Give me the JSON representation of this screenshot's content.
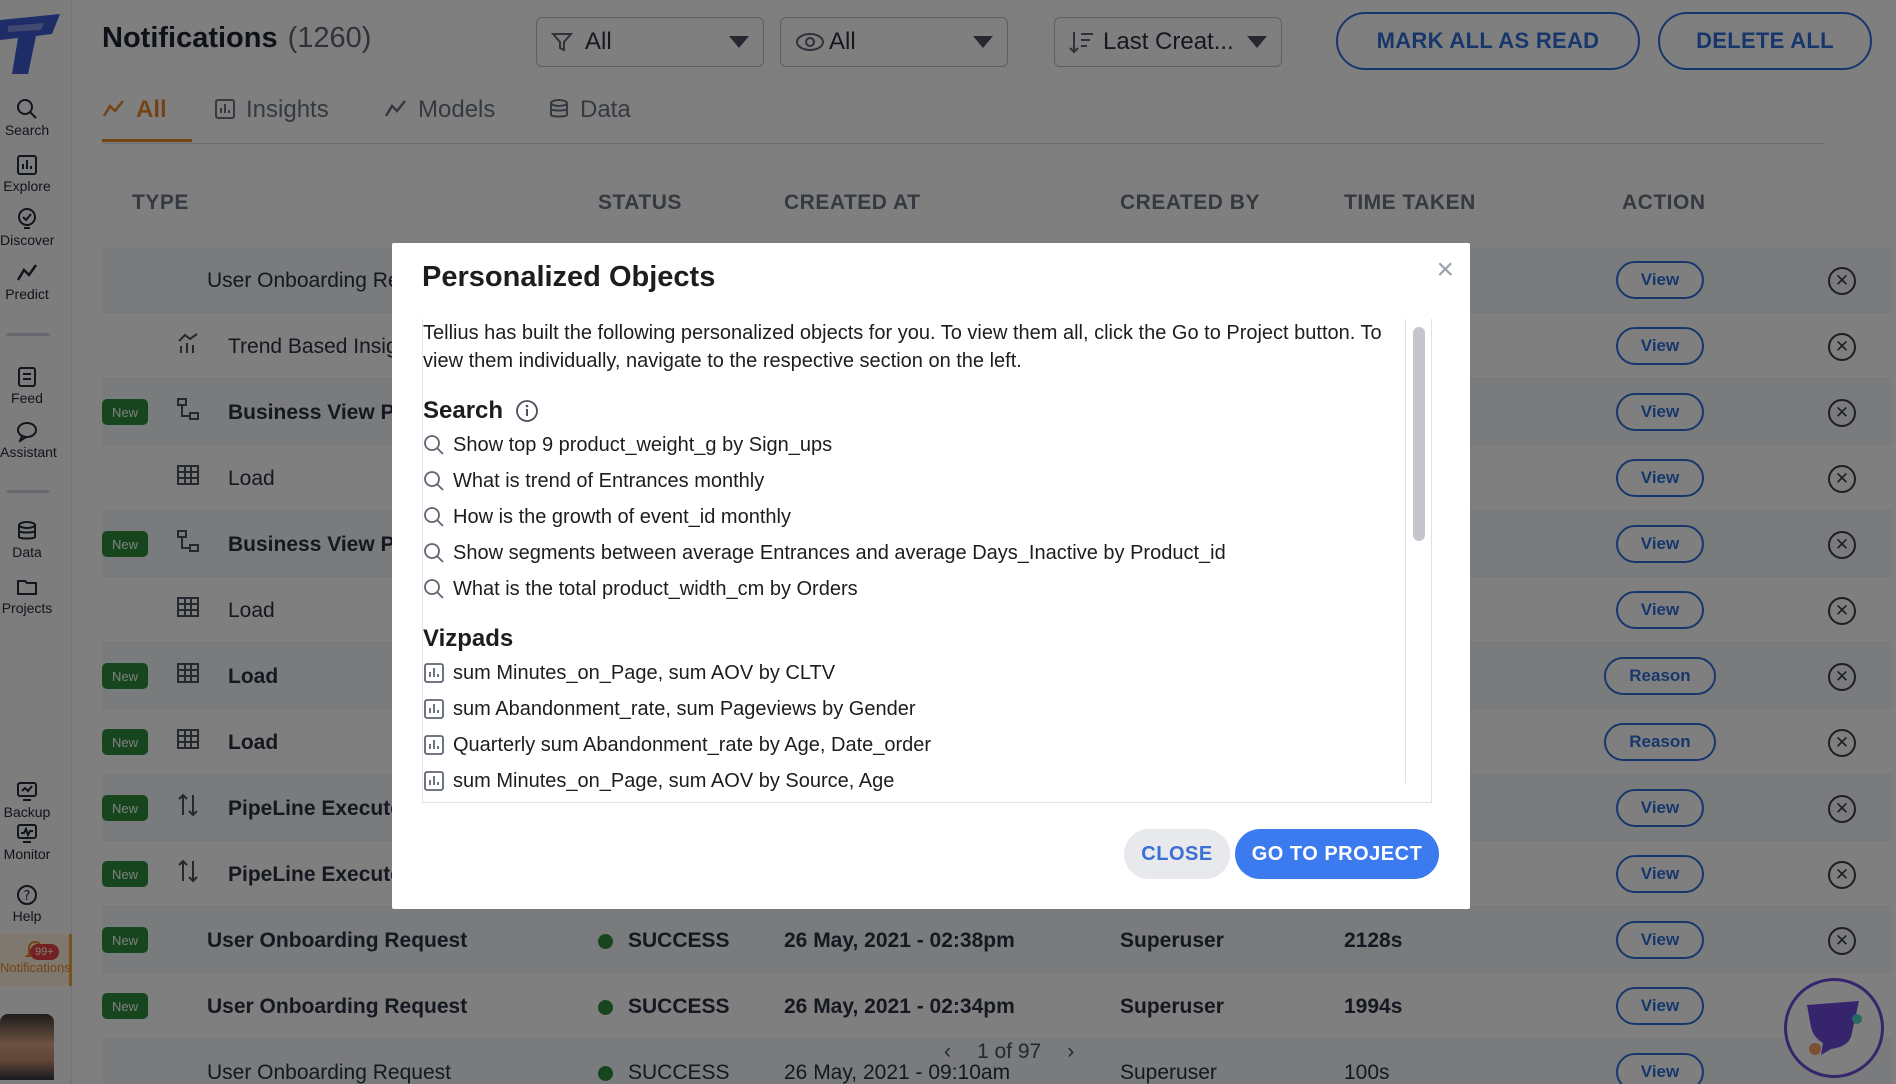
{
  "sidebar": {
    "items": [
      {
        "label": "Search"
      },
      {
        "label": "Explore"
      },
      {
        "label": "Discover"
      },
      {
        "label": "Predict"
      },
      {
        "label": "Feed"
      },
      {
        "label": "Assistant"
      },
      {
        "label": "Data"
      },
      {
        "label": "Projects"
      },
      {
        "label": "Backup"
      },
      {
        "label": "Monitor"
      },
      {
        "label": "Help"
      }
    ],
    "notifications": {
      "label": "Notifications",
      "badge": "99+"
    }
  },
  "header": {
    "title": "Notifications",
    "count": "(1260)",
    "filter_type": "All",
    "filter_read": "All",
    "sort": "Last Creat...",
    "mark_all_read_label": "MARK ALL AS READ",
    "delete_all_label": "DELETE ALL"
  },
  "tabs": [
    {
      "label": "All",
      "active": true
    },
    {
      "label": "Insights"
    },
    {
      "label": "Models"
    },
    {
      "label": "Data"
    }
  ],
  "table": {
    "columns": [
      "TYPE",
      "STATUS",
      "CREATED AT",
      "CREATED BY",
      "TIME TAKEN",
      "ACTION"
    ],
    "rows": [
      {
        "new": false,
        "icon": "none",
        "type": "User Onboarding Re",
        "action": "View"
      },
      {
        "new": false,
        "icon": "insight-icon",
        "type": "Trend Based Insig",
        "action": "View"
      },
      {
        "new": true,
        "icon": "business-view-icon",
        "type": "Business View Pu",
        "action": "View"
      },
      {
        "new": false,
        "icon": "table-icon",
        "type": "Load",
        "action": "View"
      },
      {
        "new": true,
        "icon": "business-view-icon",
        "type": "Business View Pu",
        "action": "View"
      },
      {
        "new": false,
        "icon": "table-icon",
        "type": "Load",
        "action": "View"
      },
      {
        "new": true,
        "icon": "table-icon",
        "type": "Load",
        "action": "Reason"
      },
      {
        "new": true,
        "icon": "table-icon",
        "type": "Load",
        "action": "Reason"
      },
      {
        "new": true,
        "icon": "pipeline-icon",
        "type": "PipeLine Execute",
        "action": "View"
      },
      {
        "new": true,
        "icon": "pipeline-icon",
        "type": "PipeLine Execute",
        "action": "View"
      },
      {
        "new": true,
        "icon": "none",
        "type": "User Onboarding Request",
        "status": "SUCCESS",
        "created_at": "26 May, 2021 - 02:38pm",
        "created_by": "Superuser",
        "time_taken": "2128s",
        "action": "View"
      },
      {
        "new": true,
        "icon": "none",
        "type": "User Onboarding Request",
        "status": "SUCCESS",
        "created_at": "26 May, 2021 - 02:34pm",
        "created_by": "Superuser",
        "time_taken": "1994s",
        "action": "View"
      },
      {
        "new": false,
        "icon": "none",
        "type": "User Onboarding Request",
        "status": "SUCCESS",
        "created_at": "26 May, 2021 - 09:10am",
        "created_by": "Superuser",
        "time_taken": "100s",
        "action": "View"
      }
    ],
    "new_badge": "New"
  },
  "pager": {
    "text": "1 of 97"
  },
  "modal": {
    "title": "Personalized Objects",
    "description": "Tellius has built the following personalized objects for you. To view them all, click the Go to Project button. To view them individually, navigate to the respective section on the left.",
    "search_heading": "Search",
    "search_items": [
      "Show top 9 product_weight_g by Sign_ups",
      "What is trend of Entrances monthly",
      "How is the growth of event_id monthly",
      "Show segments between average Entrances and average Days_Inactive by Product_id",
      "What is the total product_width_cm by Orders"
    ],
    "vizpads_heading": "Vizpads",
    "vizpad_items": [
      "sum Minutes_on_Page, sum AOV by CLTV",
      "sum Abandonment_rate, sum Pageviews by Gender",
      "Quarterly sum Abandonment_rate by Age, Date_order",
      "sum Minutes_on_Page, sum AOV by Source, Age"
    ],
    "close_label": "CLOSE",
    "go_label": "GO TO PROJECT"
  }
}
